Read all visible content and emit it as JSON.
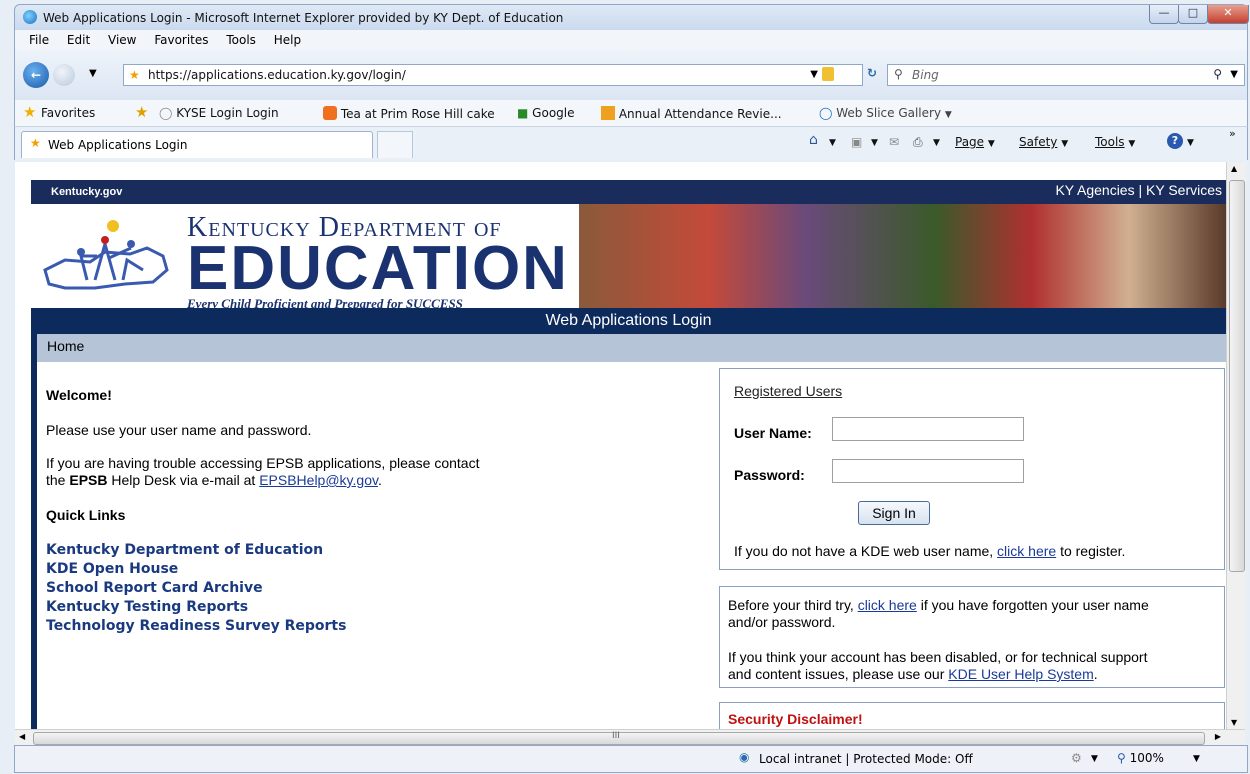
{
  "window": {
    "title": "Web Applications Login - Microsoft Internet Explorer provided by KY Dept. of Education"
  },
  "menu": [
    "File",
    "Edit",
    "View",
    "Favorites",
    "Tools",
    "Help"
  ],
  "address": {
    "url": "https://applications.education.ky.gov/login/",
    "search_placeholder": "Bing"
  },
  "favorites_bar": {
    "label": "Favorites",
    "items": [
      "KYSE Login Login",
      "Tea at Prim Rose Hill cake",
      "Google",
      "Annual Attendance Revie...",
      "Web Slice Gallery"
    ]
  },
  "tab": {
    "title": "Web Applications Login"
  },
  "toolbar": {
    "page": "Page",
    "safety": "Safety",
    "tools": "Tools"
  },
  "page": {
    "kygov": "Kentucky.gov",
    "agencies": "KY Agencies | KY Services",
    "header1": "Kentucky Department of",
    "header2": "EDUCATION",
    "tagline": "Every Child Proficient and Prepared for SUCCESS",
    "nav_title": "Web Applications Login",
    "home": "Home",
    "welcome": "Welcome!",
    "intro": "Please use your user name and password.",
    "trouble_1": "If you are having trouble accessing EPSB applications, please contact",
    "trouble_2a": "the ",
    "trouble_2b": "EPSB",
    "trouble_2c": " Help Desk via e-mail at ",
    "trouble_email": "EPSBHelp@ky.gov",
    "trouble_end": ".",
    "quick_links_title": "Quick Links",
    "quick_links": [
      "Kentucky Department of Education",
      "KDE Open House",
      "School Report Card Archive",
      "Kentucky Testing Reports",
      "Technology Readiness Survey Reports"
    ],
    "registered_users": "Registered Users",
    "username_label": "User Name:",
    "password_label": "Password:",
    "sign_in": "Sign In",
    "no_account_1": "If you do not have a KDE web user name, ",
    "no_account_link": "click here",
    "no_account_2": " to register.",
    "before_1": "Before your third try, ",
    "before_link": "click here",
    "before_2": " if you have forgotten your user name",
    "before_3": "and/or password.",
    "disabled_1": "If you think your account has been disabled, or for technical support",
    "disabled_2": "and content issues, please use our ",
    "disabled_link": "KDE User Help System",
    "disabled_end": ".",
    "security": "Security Disclaimer!"
  },
  "status": {
    "zone": "Local intranet | Protected Mode: Off",
    "zoom": "100%",
    "hscroll_mark": "III"
  }
}
